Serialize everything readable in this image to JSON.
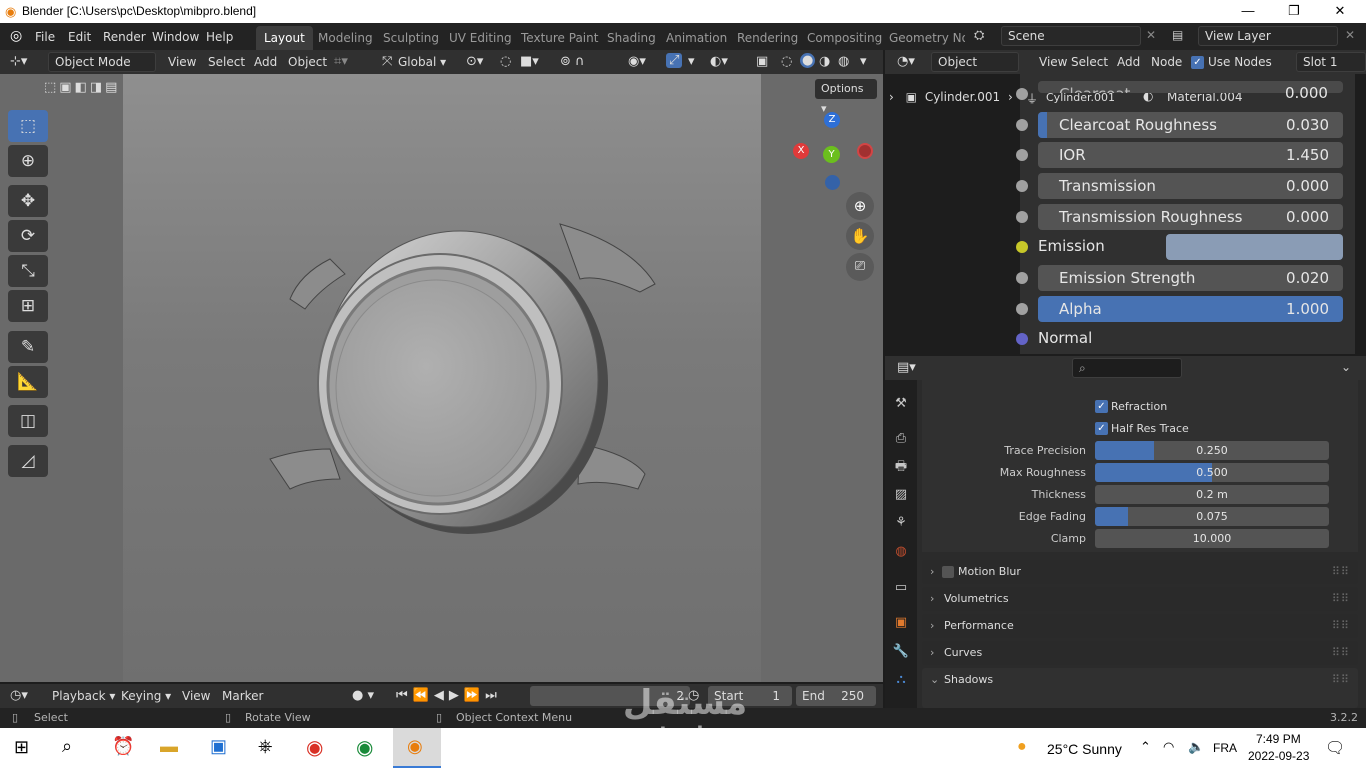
{
  "window": {
    "title": "Blender [C:\\Users\\pc\\Desktop\\mibpro.blend]",
    "minimize": "—",
    "maximize": "❐",
    "close": "✕"
  },
  "menus": [
    "File",
    "Edit",
    "Render",
    "Window",
    "Help"
  ],
  "workspaces": [
    "Layout",
    "Modeling",
    "Sculpting",
    "UV Editing",
    "Texture Paint",
    "Shading",
    "Animation",
    "Rendering",
    "Compositing",
    "Geometry Noc"
  ],
  "scene": {
    "name": "Scene",
    "view_layer": "View Layer"
  },
  "viewport": {
    "mode": "Object Mode",
    "menus": [
      "View",
      "Select",
      "Add",
      "Object"
    ],
    "transform_orientation": "Global",
    "options_label": "Options",
    "gizmo": {
      "z": "Z",
      "y": "Y",
      "x": "X"
    }
  },
  "node_editor": {
    "editor_type": "Object",
    "menus": [
      "View",
      "Select",
      "Add",
      "Node"
    ],
    "use_nodes_label": "Use Nodes",
    "slot": "Slot 1",
    "breadcrumb": {
      "object": "Cylinder.001",
      "mesh": "Cylinder.001",
      "material": "Material.004"
    },
    "inputs": [
      {
        "label": "Clearcoat",
        "value": "0.000",
        "fill": 0.0
      },
      {
        "label": "Clearcoat Roughness",
        "value": "0.030",
        "fill": 0.03
      },
      {
        "label": "IOR",
        "value": "1.450",
        "fill": 0.0
      },
      {
        "label": "Transmission",
        "value": "0.000",
        "fill": 0.0
      },
      {
        "label": "Transmission Roughness",
        "value": "0.000",
        "fill": 0.0
      },
      {
        "label": "Emission",
        "value": "",
        "fill": 0.0
      },
      {
        "label": "Emission Strength",
        "value": "0.020",
        "fill": 0.0
      },
      {
        "label": "Alpha",
        "value": "1.000",
        "fill": 1.0
      },
      {
        "label": "Normal",
        "value": "",
        "fill": 0.0
      }
    ],
    "emission_color": "#8a9cb5"
  },
  "properties": {
    "search_placeholder": "",
    "checkboxes": [
      {
        "label": "Refraction",
        "checked": true
      },
      {
        "label": "Half Res Trace",
        "checked": true
      }
    ],
    "fields": [
      {
        "label": "Trace Precision",
        "value": "0.250",
        "fill": 0.25
      },
      {
        "label": "Max Roughness",
        "value": "0.500",
        "fill": 0.5
      },
      {
        "label": "Thickness",
        "value": "0.2 m",
        "fill": 0.0
      },
      {
        "label": "Edge Fading",
        "value": "0.075",
        "fill": 0.14
      },
      {
        "label": "Clamp",
        "value": "10.000",
        "fill": 0.0
      }
    ],
    "panels": [
      "Motion Blur",
      "Volumetrics",
      "Performance",
      "Curves",
      "Shadows"
    ]
  },
  "timeline": {
    "menus": [
      "Playback",
      "Keying",
      "View",
      "Marker"
    ],
    "current_frame": "2",
    "start_label": "Start",
    "start": "1",
    "end_label": "End",
    "end": "250"
  },
  "statusbar": {
    "select": "Select",
    "rotate": "Rotate View",
    "context": "Object Context Menu",
    "version": "3.2.2"
  },
  "watermark": {
    "text": "mostaql.com"
  },
  "taskbar": {
    "weather": "25°C  Sunny",
    "lang": "FRA",
    "time": "7:49 PM",
    "date": "2022-09-23"
  },
  "colors": {
    "accent": "#4772b3",
    "bg": "#303030",
    "viewport": "#7c7c7c"
  }
}
